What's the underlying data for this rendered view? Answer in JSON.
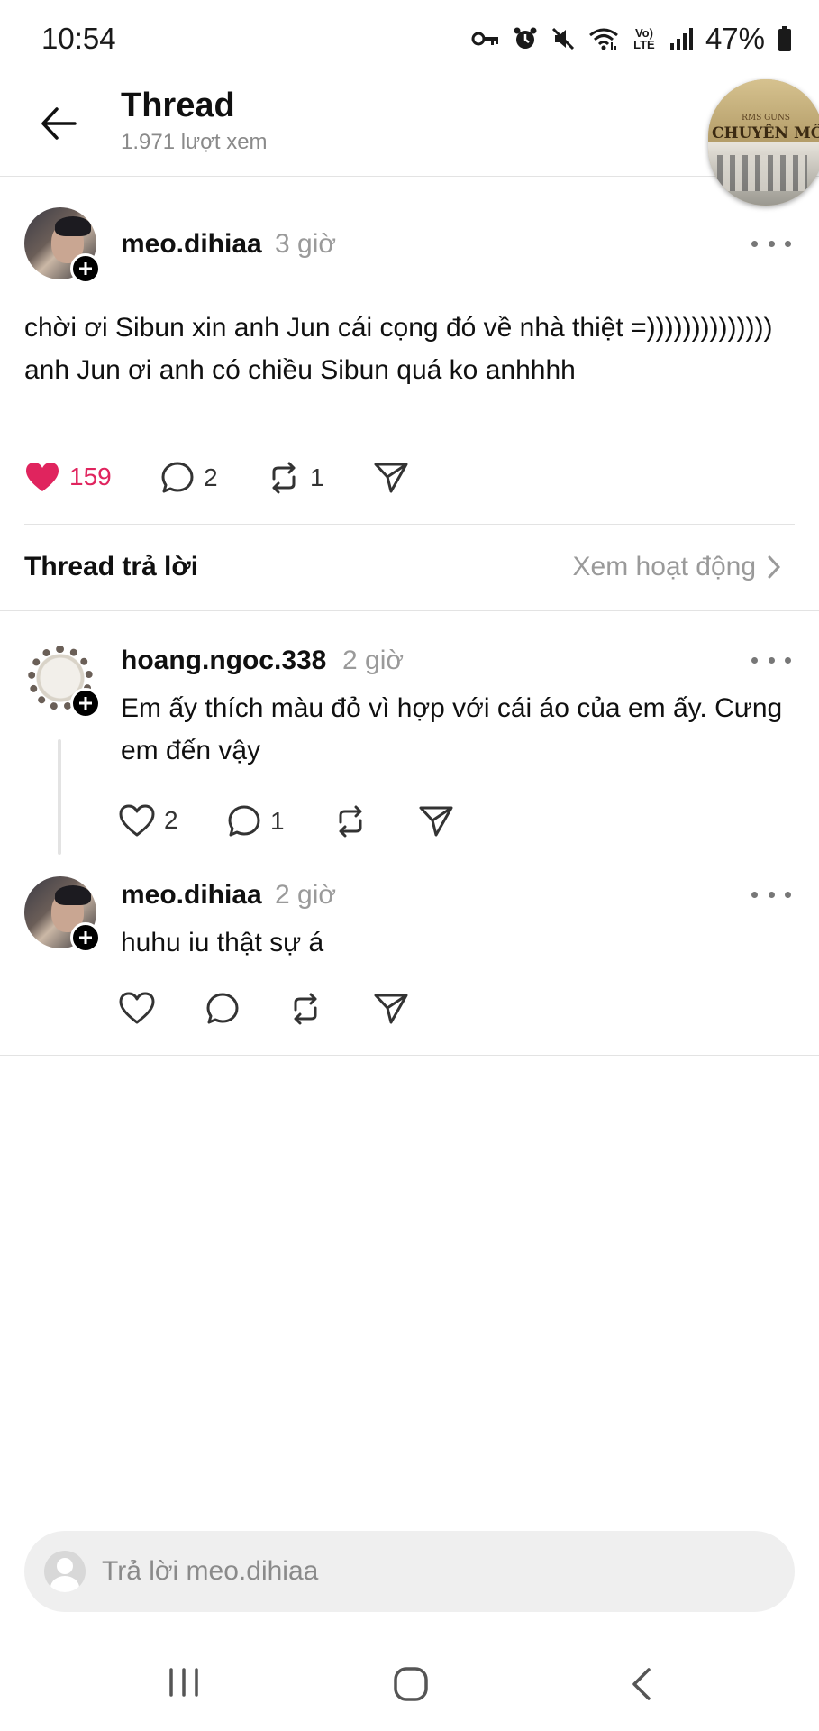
{
  "status_bar": {
    "time": "10:54",
    "battery": "47%",
    "network": "Vo) LTE",
    "icons": [
      "key-icon",
      "alarm-icon",
      "mute-icon",
      "wifi-icon",
      "volte-icon",
      "signal-icon",
      "battery-icon"
    ]
  },
  "header": {
    "title": "Thread",
    "views": "1.971 lượt xem",
    "overlay": {
      "small": "RMS GUNS",
      "brand": "CHUYÊN MÔN"
    }
  },
  "post": {
    "username": "meo.dihiaa",
    "time": "3 giờ",
    "text": "chời ơi Sibun xin anh Jun cái cọng đó về nhà thiệt =)))))))))))))) anh Jun ơi anh có chiều Sibun quá ko anhhhh",
    "likes": "159",
    "comments": "2",
    "reposts": "1",
    "liked": true,
    "like_color": "#e0245e"
  },
  "replies_section": {
    "label": "Thread trả lời",
    "activity_link": "Xem hoạt động"
  },
  "replies": [
    {
      "username": "hoang.ngoc.338",
      "time": "2 giờ",
      "text": "Em ấy thích màu đỏ vì hợp với cái áo của em ấy. Cưng em đến vậy",
      "likes": "2",
      "comments": "1"
    },
    {
      "username": "meo.dihiaa",
      "time": "2 giờ",
      "text": "huhu iu thật sự á"
    }
  ],
  "reply_box": {
    "placeholder": "Trả lời meo.dihiaa"
  }
}
